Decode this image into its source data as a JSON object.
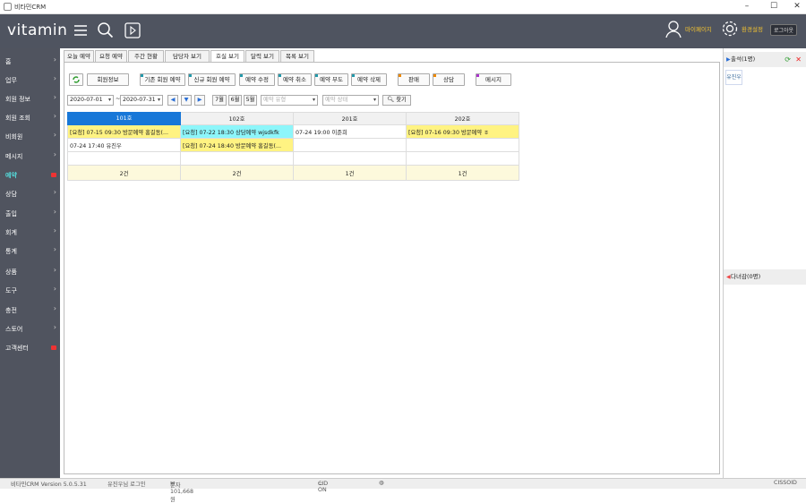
{
  "window": {
    "title": "비타민CRM",
    "min": "–",
    "max": "☐",
    "close": "✕"
  },
  "header": {
    "logo": "vitamin",
    "mypage": "마이페이지",
    "settings": "환경설정",
    "logout": "로그아웃"
  },
  "sidebar": [
    {
      "label": "홈",
      "chev": "›"
    },
    {
      "label": "업무",
      "chev": "›"
    },
    {
      "label": "회원 정보",
      "chev": "›"
    },
    {
      "label": "회원 조회",
      "chev": "›"
    },
    {
      "label": "비회원",
      "chev": "›"
    },
    {
      "label": "메시지",
      "chev": "›"
    },
    {
      "label": "예약",
      "badge": true,
      "active": true
    },
    {
      "label": "상담",
      "chev": "›"
    },
    {
      "label": "출입",
      "chev": "›"
    },
    {
      "label": "회계",
      "chev": "›"
    },
    {
      "label": "통계",
      "chev": "›"
    },
    {
      "label": "상품",
      "chev": "›"
    },
    {
      "label": "도구",
      "chev": "›"
    },
    {
      "label": "충전",
      "chev": "›"
    },
    {
      "label": "스토어",
      "chev": "›"
    },
    {
      "label": "고객센터",
      "badge": true
    }
  ],
  "tabs": [
    "오늘 예약",
    "요청 예약",
    "주간 현황",
    "담당자 보기",
    "호실 보기",
    "달력 보기",
    "목록 보기"
  ],
  "active_tab": 4,
  "toolbar": {
    "member_info": "회원정보",
    "existing_reserve": "기존 회원 예약",
    "new_reserve": "신규 회원 예약",
    "edit": "예약 수정",
    "cancel": "예약 취소",
    "absent": "예약 부도",
    "delete": "예약 삭제",
    "stand": "판매",
    "consult": "상담",
    "message": "메시지"
  },
  "filters": {
    "date_from": "2020-07-01",
    "sep": "~",
    "date_to": "2020-07-31",
    "month_7": "7월",
    "month_6": "6월",
    "month_5": "5월",
    "type_placeholder": "예약 유형",
    "status_placeholder": "예약 상태",
    "search": "찾기"
  },
  "grid": {
    "columns": [
      "101호",
      "102호",
      "201호",
      "202호"
    ],
    "rows": [
      [
        "[요청] 07-15 09:30 방문예약 홍길동(...",
        "[요청] 07-22 18:30 상담예약 wjsdkfk",
        "07-24 19:00 이준희",
        "[요청] 07-16 09:30 방문예약 ㅎ"
      ],
      [
        "07-24 17:40 유진우",
        "[요청] 07-24 18:40 방문예약 홍길동(...",
        "",
        ""
      ],
      [
        "",
        "",
        "",
        ""
      ]
    ],
    "totals": [
      "2건",
      "2건",
      "1건",
      "1건"
    ]
  },
  "right": {
    "attend": "출석(1명)",
    "attend_name": "유진우",
    "leave": "다녀감(0명)"
  },
  "status": {
    "version": "비타민CRM Version 5.0.5.31",
    "login": "유진우님 로그인",
    "sms": "문자 101,668원",
    "cid": "CID ON",
    "sso": "CISSOID"
  },
  "colors": {
    "sidebar": "#50545f",
    "header": "#4f5460",
    "accent": "#1777d8",
    "yellow": "#fff382",
    "cyan": "#8df6fa"
  }
}
